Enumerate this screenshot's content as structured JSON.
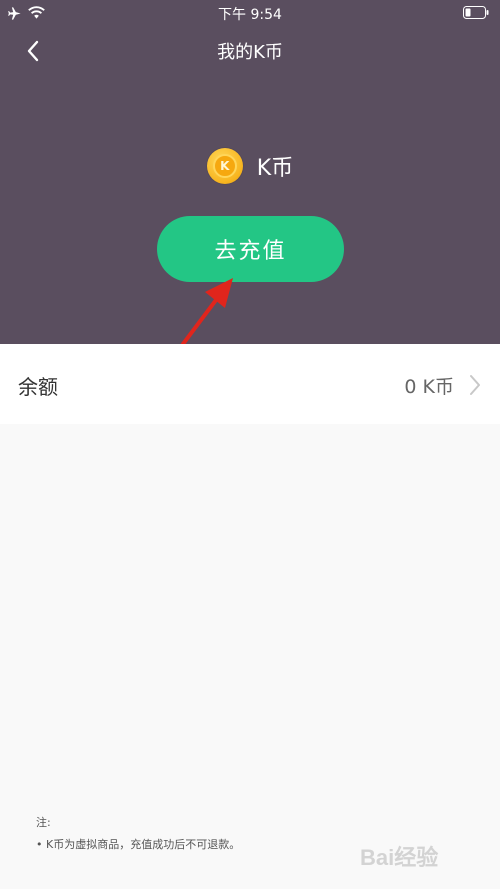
{
  "status_bar": {
    "time": "下午 9:54",
    "icons": [
      "airplane-icon",
      "wifi-icon",
      "battery-icon"
    ]
  },
  "nav": {
    "title": "我的K币",
    "back_icon": "chevron-left-icon"
  },
  "hero": {
    "coin_glyph": "K",
    "coin_label": "K币",
    "recharge_button": "去充值"
  },
  "balance": {
    "label": "余额",
    "value": "0 K币"
  },
  "notes": {
    "title": "注:",
    "items": [
      "• K币为虚拟商品，充值成功后不可退款。"
    ]
  },
  "watermark": {
    "text": "Bai经验"
  },
  "colors": {
    "header_bg": "#5a4e5f",
    "button_green": "#23c685",
    "coin_gold": "#f7b41e",
    "arrow_red": "#e0251c"
  }
}
